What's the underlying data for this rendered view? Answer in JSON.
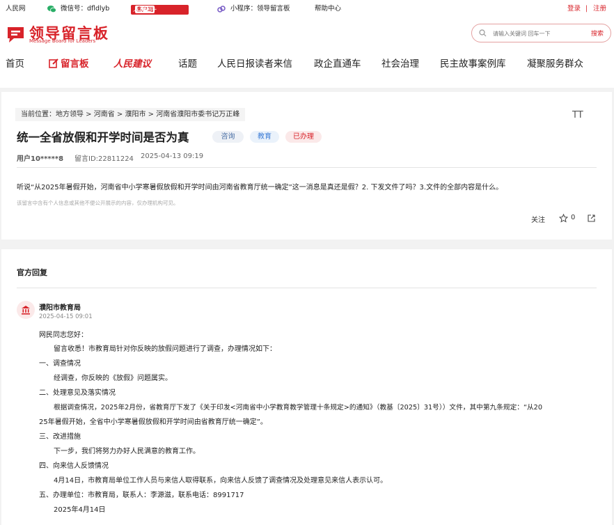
{
  "topbar": {
    "site": "人民网",
    "wechat": "微信号：dfldlyb",
    "app_name": "人民网+",
    "app_badge": "客户端",
    "mini": "小程序：领导留言板",
    "help": "帮助中心",
    "login": "登录",
    "sep": "|",
    "register": "注册"
  },
  "logo": {
    "title": "领导留言板",
    "subtitle": "Message Board for Leaders"
  },
  "search": {
    "placeholder": "请输入关键词 回车一下",
    "button": "搜索"
  },
  "nav": [
    "首页",
    "留言板",
    "人民建议",
    "话题",
    "人民日报读者来信",
    "政企直通车",
    "社会治理",
    "民主故事案例库",
    "凝聚服务群众"
  ],
  "breadcrumb": "当前位置：地方领导 > 河南省 > 濮阳市 > 河南省濮阳市委书记万正峰",
  "font_toggle": "TT",
  "message": {
    "title": "统一全省放假和开学时间是否为真",
    "tags": [
      {
        "label": "咨询",
        "color": "#4a6fa5",
        "bg": "#eef1f6"
      },
      {
        "label": "教育",
        "color": "#3a7bd5",
        "bg": "#eaf2fb"
      },
      {
        "label": "已办理",
        "color": "#d8232a",
        "bg": "#fbe9e9"
      }
    ],
    "user": "用户10*****8",
    "id": "留言ID:22811224",
    "time": "2025-04-13 09:19",
    "content": "听说“从2025年暑假开始，河南省中小学寒暑假放假和开学时间由河南省教育厅统一确定”这一消息是真还是假？2. 下发文件了吗？3.文件的全部内容是什么。",
    "note": "该留言中含有个人信息或其他不便公开展示的内容，仅办理机构可见。",
    "follow": "关注",
    "likes": "0"
  },
  "reply": {
    "section_title": "官方回复",
    "org": "濮阳市教育局",
    "date": "2025-04-15 09:01",
    "lines": [
      "网民同志您好：",
      "留言收悉！市教育局针对你反映的放假问题进行了调查，办理情况如下：",
      "一、调查情况",
      "经调查，你反映的《放假》问题属实。",
      "二、处理意见及落实情况",
      "根据调查情况，2025年2月份，省教育厅下发了《关于印发<河南省中小学教育教学管理十条规定>的通知》（教基〔2025〕31号））文件，其中第九条规定：“从20",
      "25年暑假开始，全省中小学寒暑假放假和开学时间由省教育厅统一确定”。",
      "三、改进措施",
      "下一步，我们将努力办好人民满意的教育工作。",
      "四、向来信人反馈情况",
      "4月14日，市教育局单位工作人员与来信人取得联系，向来信人反馈了调查情况及处理意见来信人表示认可。",
      "五、办理单位：市教育局，联系人：李源滋，联系电话：8991717",
      "2025年4月14日"
    ]
  }
}
